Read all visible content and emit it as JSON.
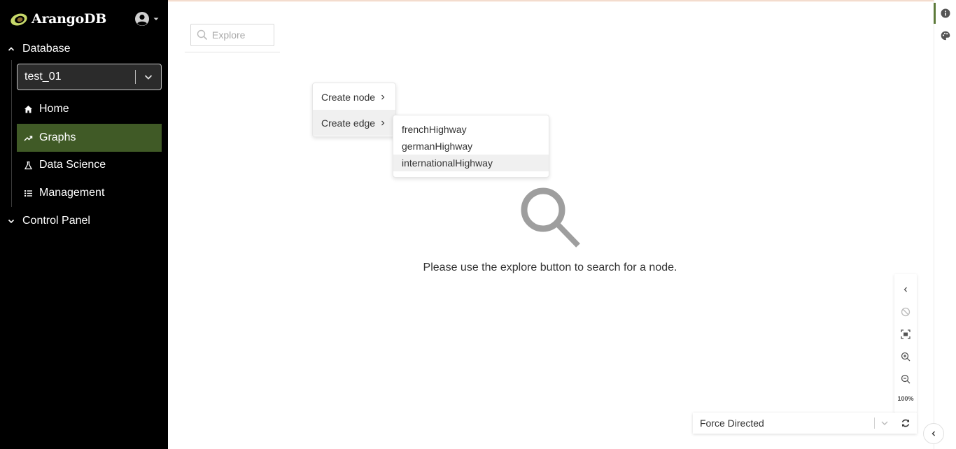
{
  "app": {
    "brand": "ArangoDB",
    "logo_icon": "arangodb-avocado-icon",
    "user_icon": "user-circle-icon"
  },
  "sidebar": {
    "database_section": "Database",
    "database_selector": {
      "value": "test_01"
    },
    "items": [
      {
        "label": "Home",
        "icon": "home-icon",
        "active": false
      },
      {
        "label": "Graphs",
        "icon": "trend-icon",
        "active": true
      },
      {
        "label": "Data Science",
        "icon": "flask-icon",
        "active": false
      },
      {
        "label": "Management",
        "icon": "list-icon",
        "active": false
      }
    ],
    "control_panel_section": "Control Panel"
  },
  "search": {
    "placeholder": "Explore"
  },
  "context_menu": {
    "items": [
      {
        "label": "Create node"
      },
      {
        "label": "Create edge"
      }
    ],
    "submenu": {
      "items": [
        {
          "label": "frenchHighway"
        },
        {
          "label": "germanHighway"
        },
        {
          "label": "internationalHighway"
        }
      ]
    }
  },
  "empty_state": {
    "message": "Please use the explore button to search for a node."
  },
  "graph_controls": {
    "zoom": "100%"
  },
  "layout_select": {
    "value": "Force Directed"
  },
  "colors": {
    "sidebar_bg": "#000000",
    "active_nav": "#405a26",
    "accent_green": "#5d7a3a"
  }
}
